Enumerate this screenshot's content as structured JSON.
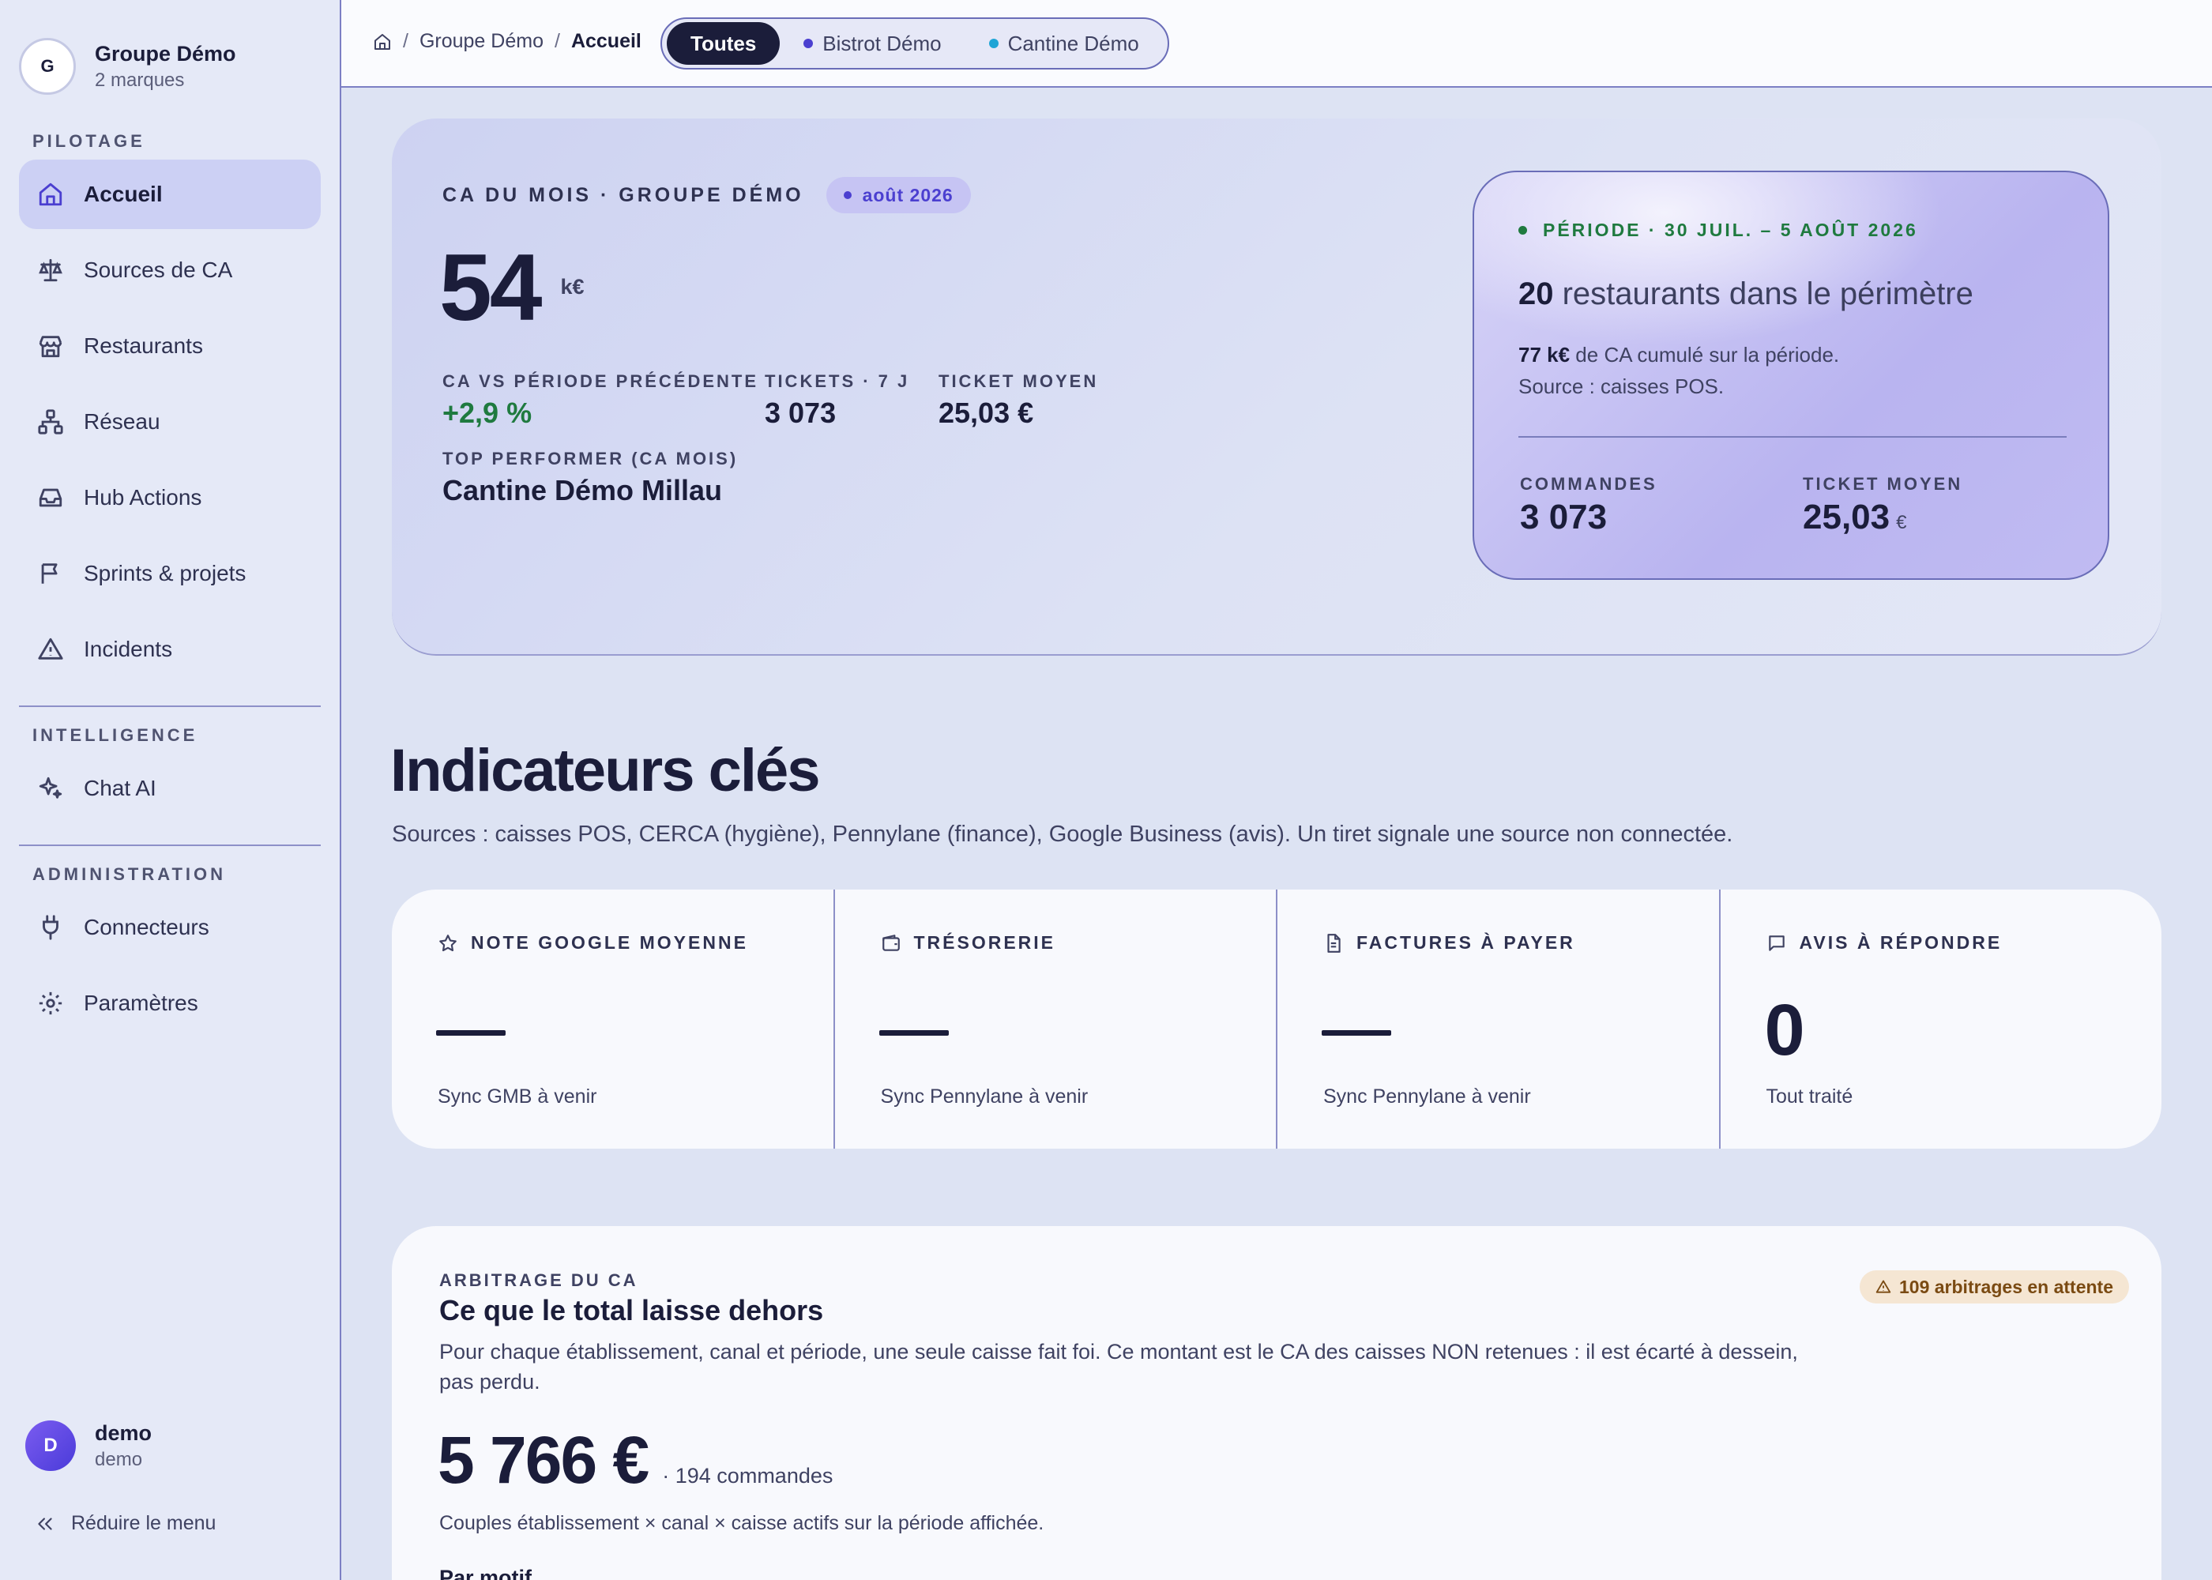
{
  "sidebar": {
    "org_initial": "G",
    "org_name": "Groupe Démo",
    "org_sub": "2 marques",
    "sections": [
      "PILOTAGE",
      "INTELLIGENCE",
      "ADMINISTRATION"
    ],
    "items": [
      {
        "label": "Accueil",
        "icon": "home-icon"
      },
      {
        "label": "Sources de CA",
        "icon": "scale-icon"
      },
      {
        "label": "Restaurants",
        "icon": "store-icon"
      },
      {
        "label": "Réseau",
        "icon": "network-icon"
      },
      {
        "label": "Hub Actions",
        "icon": "inbox-icon"
      },
      {
        "label": "Sprints & projets",
        "icon": "flag-icon"
      },
      {
        "label": "Incidents",
        "icon": "alert-triangle-icon"
      },
      {
        "label": "Chat AI",
        "icon": "sparkles-icon"
      },
      {
        "label": "Connecteurs",
        "icon": "plug-icon"
      },
      {
        "label": "Paramètres",
        "icon": "gear-icon"
      }
    ],
    "user": {
      "initial": "D",
      "name": "demo",
      "sub": "demo"
    },
    "collapse_label": "Réduire le menu"
  },
  "topbar": {
    "breadcrumb": [
      "Groupe Démo",
      "Accueil"
    ],
    "brands": [
      {
        "label": "Toutes",
        "color": ""
      },
      {
        "label": "Bistrot Démo",
        "color": "#4b3fd0"
      },
      {
        "label": "Cantine Démo",
        "color": "#1fa5d6"
      }
    ]
  },
  "hero": {
    "kicker": "CA DU MOIS · GROUPE DÉMO",
    "month": "août 2026",
    "value": "54",
    "unit": "k€",
    "kpis": [
      {
        "label": "CA VS PÉRIODE PRÉCÉDENTE",
        "value": "+2,9 %"
      },
      {
        "label": "TICKETS · 7 J",
        "value": "3 073"
      },
      {
        "label": "TICKET MOYEN",
        "value": "25,03 €"
      }
    ],
    "top_label": "TOP PERFORMER (CA MOIS)",
    "top_value": "Cantine Démo Millau",
    "period": {
      "kicker": "PÉRIODE · 30 JUIL. – 5 AOÛT 2026",
      "count": "20",
      "title_rest": " restaurants dans le périmètre",
      "cumul_strong": "77 k€",
      "cumul_rest": " de CA cumulé sur la période.",
      "source": "Source : caisses POS.",
      "orders_label": "COMMANDES",
      "orders_value": "3 073",
      "avg_label": "TICKET MOYEN",
      "avg_value": "25,03",
      "avg_unit": "€"
    }
  },
  "indicators": {
    "title": "Indicateurs clés",
    "subtitle": "Sources : caisses POS, CERCA (hygiène), Pennylane (finance), Google Business (avis). Un tiret signale une source non connectée.",
    "cards": [
      {
        "label": "NOTE GOOGLE MOYENNE",
        "value": "—",
        "foot": "Sync GMB à venir",
        "icon": "star-icon"
      },
      {
        "label": "TRÉSORERIE",
        "value": "—",
        "foot": "Sync Pennylane à venir",
        "icon": "wallet-icon"
      },
      {
        "label": "FACTURES À PAYER",
        "value": "—",
        "foot": "Sync Pennylane à venir",
        "icon": "file-icon"
      },
      {
        "label": "AVIS À RÉPONDRE",
        "value": "0",
        "foot": "Tout traité",
        "icon": "message-icon"
      }
    ]
  },
  "arbitrage": {
    "kicker": "ARBITRAGE DU CA",
    "title": "Ce que le total laisse dehors",
    "description": "Pour chaque établissement, canal et période, une seule caisse fait foi. Ce montant est le CA des caisses NON retenues : il est écarté à dessein, pas perdu.",
    "badge": "109 arbitrages en attente",
    "value": "5 766 €",
    "orders": "· 194 commandes",
    "note": "Couples établissement × canal × caisse actifs sur la période affichée.",
    "motif": "Par motif"
  }
}
